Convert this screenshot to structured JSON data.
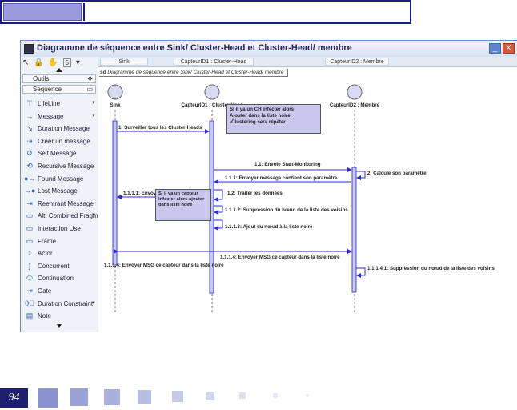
{
  "window": {
    "title": "Diagramme de séquence entre Sink/ Cluster-Head et Cluster-Head/ membre",
    "minimize_symbol": "_",
    "close_symbol": "X"
  },
  "palette": {
    "toolbar_badge": "5",
    "groups": [
      {
        "label": "Outils"
      },
      {
        "label": "Sequence"
      }
    ],
    "items": [
      {
        "label": "LifeLine",
        "icon": "lifeline-icon",
        "glyph": "⊤",
        "dropdown": true
      },
      {
        "label": "Message",
        "icon": "message-icon",
        "glyph": "→",
        "dropdown": true
      },
      {
        "label": "Duration Message",
        "icon": "duration-message-icon",
        "glyph": "↘",
        "dropdown": false
      },
      {
        "label": "Créer un message",
        "icon": "create-message-icon",
        "glyph": "⇢",
        "dropdown": false
      },
      {
        "label": "Self Message",
        "icon": "self-message-icon",
        "glyph": "↺",
        "dropdown": false
      },
      {
        "label": "Recursive Message",
        "icon": "recursive-message-icon",
        "glyph": "⟲",
        "dropdown": false
      },
      {
        "label": "Found Message",
        "icon": "found-message-icon",
        "glyph": "●→",
        "dropdown": false
      },
      {
        "label": "Lost Message",
        "icon": "lost-message-icon",
        "glyph": "→●",
        "dropdown": false
      },
      {
        "label": "Reentrant Message",
        "icon": "reentrant-message-icon",
        "glyph": "⇥",
        "dropdown": false
      },
      {
        "label": "Alt. Combined Fragme",
        "icon": "combined-fragment-icon",
        "glyph": "▭",
        "dropdown": true
      },
      {
        "label": "Interaction Use",
        "icon": "interaction-use-icon",
        "glyph": "▭",
        "dropdown": false
      },
      {
        "label": "Frame",
        "icon": "frame-icon",
        "glyph": "▭",
        "dropdown": false
      },
      {
        "label": "Actor",
        "icon": "actor-icon",
        "glyph": "♀",
        "dropdown": false
      },
      {
        "label": "Concurrent",
        "icon": "concurrent-icon",
        "glyph": "}",
        "dropdown": false
      },
      {
        "label": "Continuation",
        "icon": "continuation-icon",
        "glyph": "⬭",
        "dropdown": false
      },
      {
        "label": "Gate",
        "icon": "gate-icon",
        "glyph": "⇥",
        "dropdown": false
      },
      {
        "label": "Duration Constraint",
        "icon": "duration-constraint-icon",
        "glyph": "0⃣",
        "dropdown": true
      },
      {
        "label": "Note",
        "icon": "note-icon",
        "glyph": "▤",
        "dropdown": false
      }
    ]
  },
  "diagram": {
    "header_tabs": [
      "Sink",
      "CapteurID1 : Cluster-Head",
      "CapteurID2 : Membre"
    ],
    "frame_prefix": "sd",
    "frame_label": "Diagramme de séquence entre Sink/ Cluster-Head et Cluster-Head/ membre",
    "lifelines": [
      "Sink",
      "CapteurID1 : Cluster-Head",
      "CapteurID2 : Membre"
    ],
    "messages": [
      "1: Surveiller tous les Cluster-Heads",
      "1.1: Envoie Start-Monitoring",
      "2: Calcule son paramètre",
      "1.1.1: Envoyer message contient son paramètre",
      "1.1.1.1: Envoyer les données",
      "1.2: Traiter les données",
      "1.1.1.2: Suppression du nœud de la liste des voisins",
      "1.1.1.3: Ajout du nœud à la liste noire",
      "1.1.1.4: Envoyer MSG ce capteur dans la liste noire",
      "1.1.1.4: Envoyer MSG ce capteur dans la liste noire",
      "1.1.1.4.1: Suppression du nœud de la liste des voisins"
    ],
    "notes": [
      "Si il ya un CH infecter alors\n Ajouter dans la liste noire.\n-Clustering sera répéter.",
      "Si il ya un capteur infecter alors ajouter dans liste noire"
    ]
  },
  "footer": {
    "page_number": "94"
  }
}
